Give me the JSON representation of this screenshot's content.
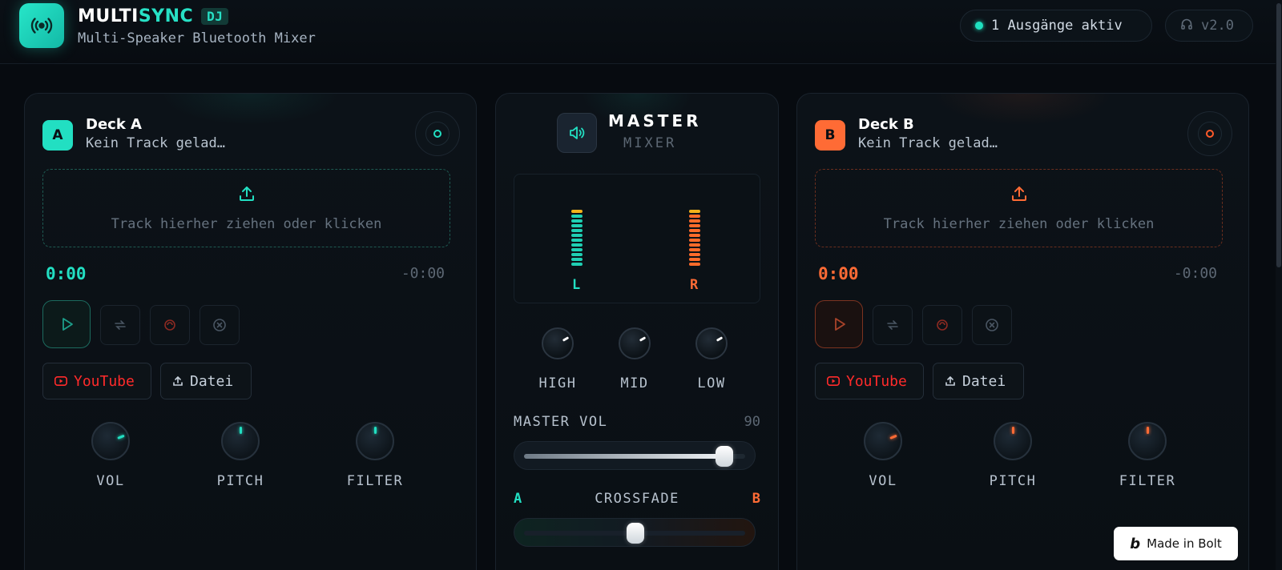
{
  "header": {
    "brand_main": "MULTI",
    "brand_accent": "SYNC",
    "brand_tag": "DJ",
    "subtitle": "Multi-Speaker Bluetooth Mixer",
    "outputs_status": "1 Ausgänge aktiv",
    "version": "v2.0"
  },
  "colors": {
    "deck_a_accent": "#22dfc2",
    "deck_b_accent": "#ff6b35",
    "youtube": "#ff2b2b",
    "background": "#070b10"
  },
  "deck_a": {
    "badge": "A",
    "title": "Deck A",
    "track": "Kein Track gelad…",
    "drop_text": "Track hierher ziehen oder klicken",
    "time_current": "0:00",
    "time_remaining": "-0:00",
    "youtube_label": "YouTube",
    "file_label": "Datei",
    "knobs": [
      {
        "label": "VOL",
        "value": 0.75
      },
      {
        "label": "PITCH",
        "value": 0.5
      },
      {
        "label": "FILTER",
        "value": 0.5
      }
    ]
  },
  "deck_b": {
    "badge": "B",
    "title": "Deck B",
    "track": "Kein Track gelad…",
    "drop_text": "Track hierher ziehen oder klicken",
    "time_current": "0:00",
    "time_remaining": "-0:00",
    "youtube_label": "YouTube",
    "file_label": "Datei",
    "knobs": [
      {
        "label": "VOL",
        "value": 0.75
      },
      {
        "label": "PITCH",
        "value": 0.5
      },
      {
        "label": "FILTER",
        "value": 0.5
      }
    ]
  },
  "master": {
    "title": "MASTER",
    "subtitle": "MIXER",
    "meter_left_label": "L",
    "meter_right_label": "R",
    "eq": [
      {
        "label": "HIGH"
      },
      {
        "label": "MID"
      },
      {
        "label": "LOW"
      }
    ],
    "volume_label": "MASTER VOL",
    "volume_value": "90",
    "volume_fraction": 0.9,
    "crossfade_a": "A",
    "crossfade_label": "CROSSFADE",
    "crossfade_b": "B",
    "crossfade_fraction": 0.5
  },
  "footer": {
    "bolt_logo": "b",
    "bolt_label": "Made in Bolt"
  }
}
